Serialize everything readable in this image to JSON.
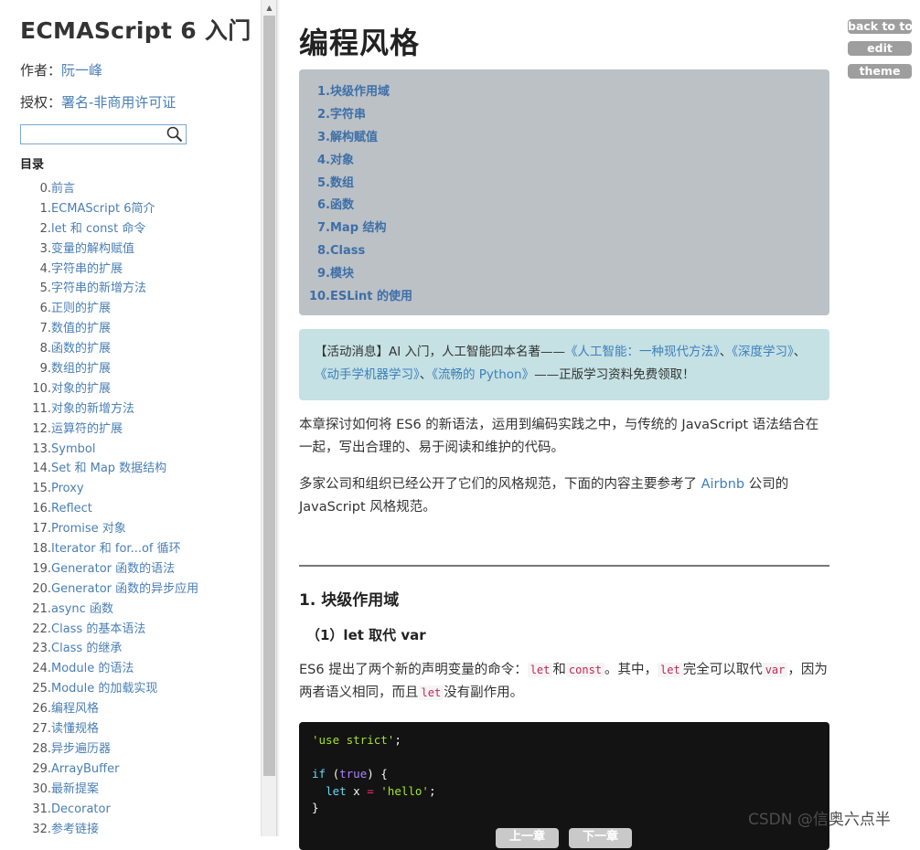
{
  "sidebar": {
    "title": "ECMAScript 6 入门",
    "author_label": "作者：",
    "author_name": "阮一峰",
    "license_label": "授权：",
    "license_name": "署名-非商用许可证",
    "search_placeholder": "",
    "toc_heading": "目录",
    "toc": [
      {
        "num": "0.",
        "label": "前言"
      },
      {
        "num": "1.",
        "label": "ECMAScript 6简介"
      },
      {
        "num": "2.",
        "label": "let 和 const 命令"
      },
      {
        "num": "3.",
        "label": "变量的解构赋值"
      },
      {
        "num": "4.",
        "label": "字符串的扩展"
      },
      {
        "num": "5.",
        "label": "字符串的新增方法"
      },
      {
        "num": "6.",
        "label": "正则的扩展"
      },
      {
        "num": "7.",
        "label": "数值的扩展"
      },
      {
        "num": "8.",
        "label": "函数的扩展"
      },
      {
        "num": "9.",
        "label": "数组的扩展"
      },
      {
        "num": "10.",
        "label": "对象的扩展"
      },
      {
        "num": "11.",
        "label": "对象的新增方法"
      },
      {
        "num": "12.",
        "label": "运算符的扩展"
      },
      {
        "num": "13.",
        "label": "Symbol"
      },
      {
        "num": "14.",
        "label": "Set 和 Map 数据结构"
      },
      {
        "num": "15.",
        "label": "Proxy"
      },
      {
        "num": "16.",
        "label": "Reflect"
      },
      {
        "num": "17.",
        "label": "Promise 对象"
      },
      {
        "num": "18.",
        "label": "Iterator 和 for...of 循环"
      },
      {
        "num": "19.",
        "label": "Generator 函数的语法"
      },
      {
        "num": "20.",
        "label": "Generator 函数的异步应用"
      },
      {
        "num": "21.",
        "label": "async 函数"
      },
      {
        "num": "22.",
        "label": "Class 的基本语法"
      },
      {
        "num": "23.",
        "label": "Class 的继承"
      },
      {
        "num": "24.",
        "label": "Module 的语法"
      },
      {
        "num": "25.",
        "label": "Module 的加载实现"
      },
      {
        "num": "26.",
        "label": "编程风格"
      },
      {
        "num": "27.",
        "label": "读懂规格"
      },
      {
        "num": "28.",
        "label": "异步遍历器"
      },
      {
        "num": "29.",
        "label": "ArrayBuffer"
      },
      {
        "num": "30.",
        "label": "最新提案"
      },
      {
        "num": "31.",
        "label": "Decorator"
      },
      {
        "num": "32.",
        "label": "参考链接"
      }
    ]
  },
  "main": {
    "title": "编程风格",
    "page_toc": [
      {
        "num": "1.",
        "label": "块级作用域"
      },
      {
        "num": "2.",
        "label": "字符串"
      },
      {
        "num": "3.",
        "label": "解构赋值"
      },
      {
        "num": "4.",
        "label": "对象"
      },
      {
        "num": "5.",
        "label": "数组"
      },
      {
        "num": "6.",
        "label": "函数"
      },
      {
        "num": "7.",
        "label": "Map 结构"
      },
      {
        "num": "8.",
        "label": "Class"
      },
      {
        "num": "9.",
        "label": "模块"
      },
      {
        "num": "10.",
        "label": "ESLint 的使用"
      }
    ],
    "notice": {
      "prefix": "【活动消息】AI 入门，人工智能四本名著——",
      "link1": "《人工智能：一种现代方法》",
      "sep1": "、",
      "link2": "《深度学习》",
      "sep2": "、",
      "link3": "《动手学机器学习》",
      "sep3": "、",
      "link4": "《流畅的 Python》",
      "suffix": "——正版学习资料免费领取！"
    },
    "intro_1": "本章探讨如何将 ES6 的新语法，运用到编码实践之中，与传统的 JavaScript 语法结合在一起，写出合理的、易于阅读和维护的代码。",
    "intro_2_before": "多家公司和组织已经公开了它们的风格规范，下面的内容主要参考了 ",
    "intro_2_link": "Airbnb",
    "intro_2_after": " 公司的 JavaScript 风格规范。",
    "section_heading": "1. 块级作用域",
    "subsection_heading": "（1）let 取代 var",
    "para_3": {
      "t1": "ES6 提出了两个新的声明变量的命令：",
      "c1": "let",
      "t2": "和",
      "c2": "const",
      "t3": "。其中，",
      "c3": "let",
      "t4": "完全可以取代",
      "c4": "var",
      "t5": "，因为两者语义相同，而且",
      "c5": "let",
      "t6": "没有副作用。"
    },
    "code": {
      "line1_str": "'use strict'",
      "line1_end": ";",
      "line3_kw": "if",
      "line3_a": " (",
      "line3_bool": "true",
      "line3_b": ") {",
      "line4_indent": "  ",
      "line4_kw": "let",
      "line4_var": " x ",
      "line4_op": "=",
      "line4_sp": " ",
      "line4_str": "'hello'",
      "line4_end": ";",
      "line5": "}"
    },
    "pager_prev": "上一章",
    "pager_next": "下一章"
  },
  "side_buttons": {
    "back_to_top": "back to top",
    "edit": "edit",
    "theme": "theme"
  },
  "watermark": "CSDN @信奥六点半"
}
